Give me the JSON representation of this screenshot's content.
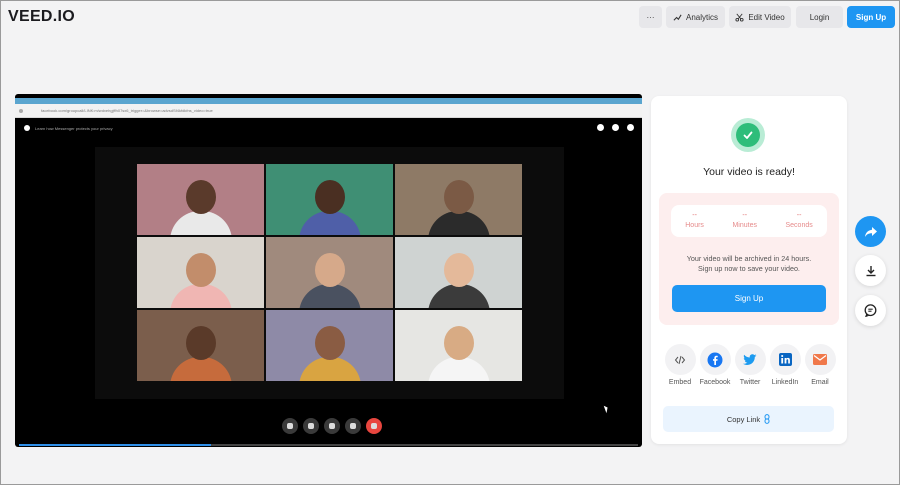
{
  "header": {
    "logo": "VEED.IO",
    "more_label": "···",
    "analytics_label": "Analytics",
    "edit_label": "Edit Video",
    "login_label": "Login",
    "signup_label": "Sign Up"
  },
  "video": {
    "url_text": "facebook.com/groupcall/LINK:m/wdxehgjffh07sx6_trigger=&browse=advsdSf4kfdkfns_video=true",
    "privacy_text": "Learn how Messenger protects your privacy",
    "progress_fraction": 0.31,
    "tiles": [
      {
        "bg": "#b27f86",
        "skin": "#5a3a2b",
        "shirt": "#e9e9e9"
      },
      {
        "bg": "#3f8f74",
        "skin": "#4a2f22",
        "shirt": "#4f5fa8"
      },
      {
        "bg": "#8e7a66",
        "skin": "#7b5a45",
        "shirt": "#2b2b2b"
      },
      {
        "bg": "#d9d4cd",
        "skin": "#c28d6b",
        "shirt": "#f0b6b3"
      },
      {
        "bg": "#a08a7d",
        "skin": "#d6a98a",
        "shirt": "#4a5160"
      },
      {
        "bg": "#cfd3d2",
        "skin": "#e4b99a",
        "shirt": "#3b3b3b"
      },
      {
        "bg": "#7b5e4c",
        "skin": "#5a3a29",
        "shirt": "#c66b3c"
      },
      {
        "bg": "#8e8aa7",
        "skin": "#8a5c43",
        "shirt": "#d9a441"
      },
      {
        "bg": "#e6e6e3",
        "skin": "#d8ab84",
        "shirt": "#f5f5f5"
      }
    ]
  },
  "panel": {
    "ready_text": "Your video is ready!",
    "timer": [
      {
        "value": "--",
        "label": "Hours"
      },
      {
        "value": "--",
        "label": "Minutes"
      },
      {
        "value": "--",
        "label": "Seconds"
      }
    ],
    "archive_line1": "Your video will be archived in 24 hours.",
    "archive_line2": "Sign up now to save your video.",
    "signup_label": "Sign Up",
    "shares": [
      {
        "label": "Embed",
        "icon": "embed-icon",
        "color": "#555555"
      },
      {
        "label": "Facebook",
        "icon": "facebook-icon",
        "color": "#1877f2"
      },
      {
        "label": "Twitter",
        "icon": "twitter-icon",
        "color": "#1d9bf0"
      },
      {
        "label": "LinkedIn",
        "icon": "linkedin-icon",
        "color": "#0a66c2"
      },
      {
        "label": "Email",
        "icon": "email-icon",
        "color": "#f0784a"
      }
    ],
    "copy_label": "Copy Link"
  },
  "colors": {
    "accent": "#1e96f2",
    "success": "#2ebd7a",
    "timer_text": "#e06c6c"
  }
}
